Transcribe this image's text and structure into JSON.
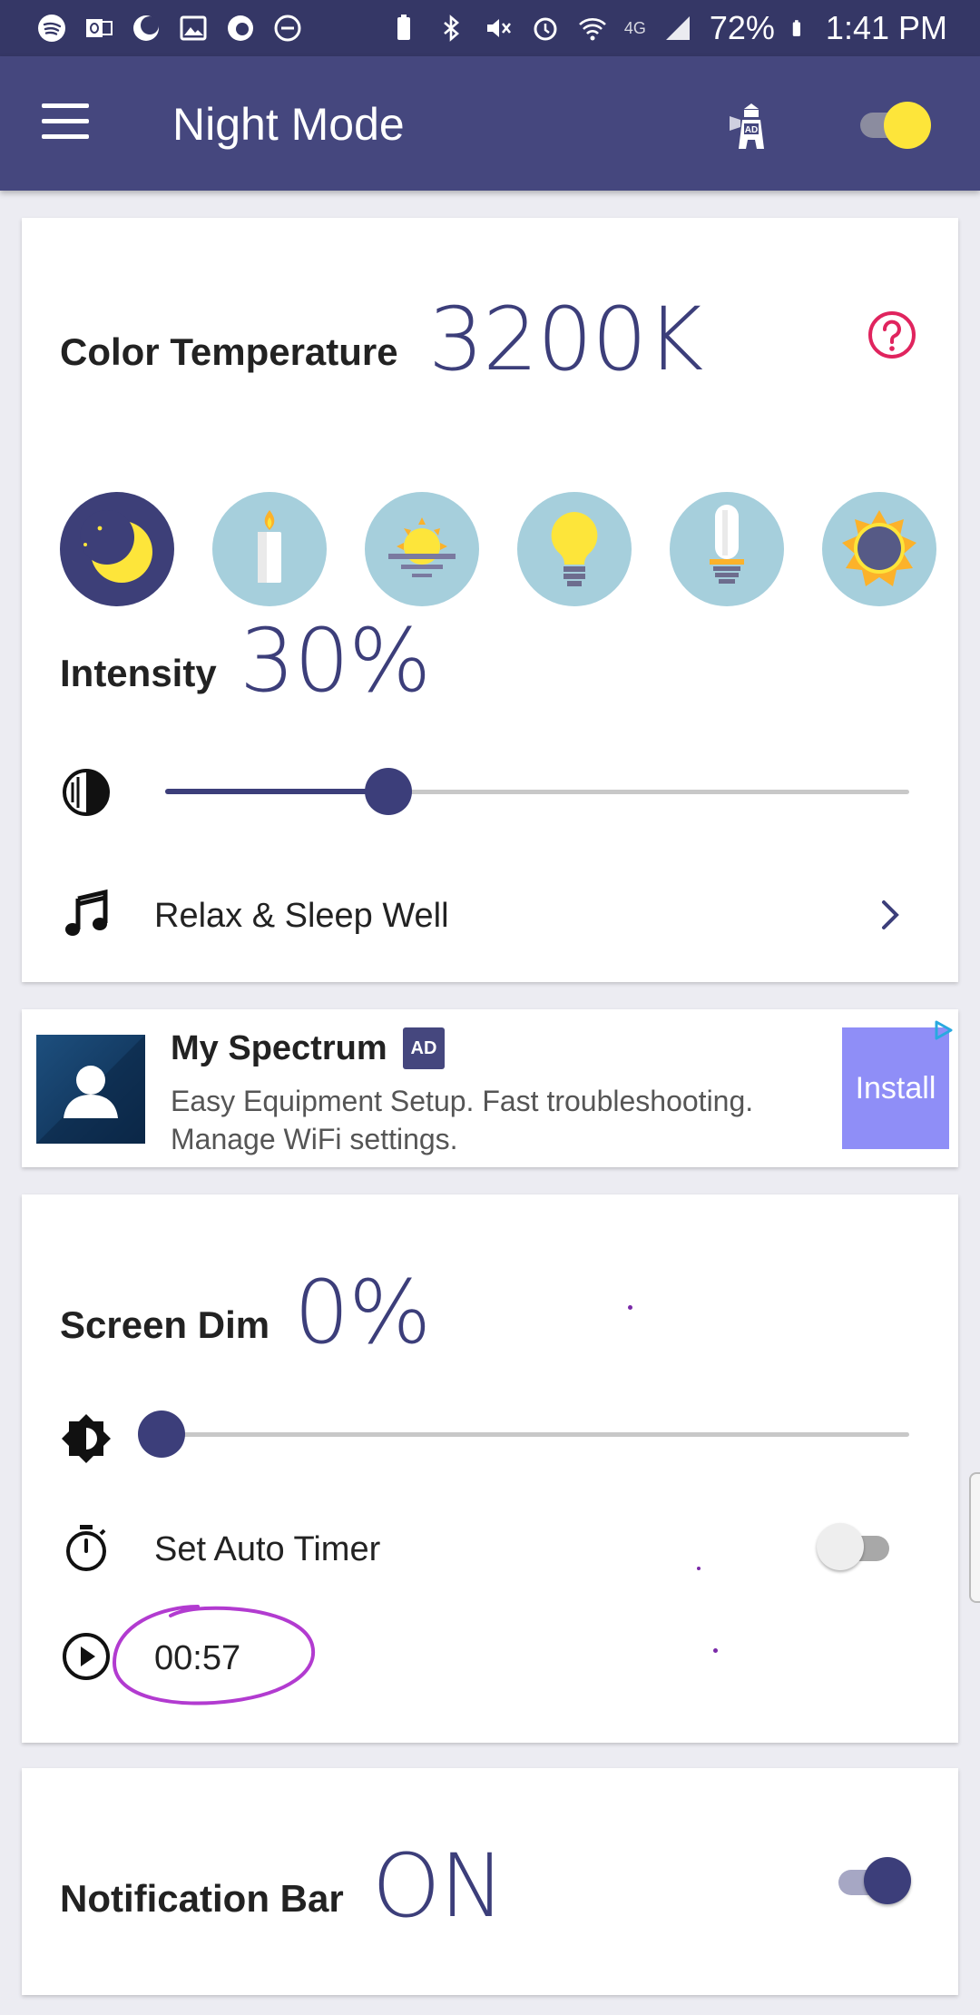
{
  "status_bar": {
    "battery": "72%",
    "time": "1:41 PM",
    "network": "4G"
  },
  "app_bar": {
    "title": "Night Mode",
    "icons": [
      "menu-icon",
      "ad-tower-icon"
    ],
    "master_switch_on": true,
    "master_switch_color": "#fde53a"
  },
  "color_temperature": {
    "label": "Color Temperature",
    "value": "3200K",
    "help_icon": "help-circle-icon",
    "presets": [
      {
        "name": "moon",
        "selected": true
      },
      {
        "name": "candle",
        "selected": false
      },
      {
        "name": "sunset",
        "selected": false
      },
      {
        "name": "bulb",
        "selected": false
      },
      {
        "name": "fluorescent",
        "selected": false
      },
      {
        "name": "sun",
        "selected": false
      }
    ]
  },
  "intensity": {
    "label": "Intensity",
    "value": "30%",
    "level": 0.3
  },
  "relax": {
    "label": "Relax & Sleep Well"
  },
  "ad": {
    "title": "My Spectrum",
    "badge": "AD",
    "description": "Easy Equipment Setup. Fast troubleshooting. Manage WiFi settings.",
    "install_label": "Install"
  },
  "screen_dim": {
    "label": "Screen Dim",
    "value": "0%",
    "level": 0.0
  },
  "auto_timer": {
    "label": "Set Auto Timer",
    "enabled": false
  },
  "timer": {
    "value": "00:57"
  },
  "notification_bar": {
    "label": "Notification Bar",
    "value": "ON",
    "enabled": true
  },
  "colors": {
    "primary": "#45477e",
    "accent": "#3c3e7a",
    "help": "#e0245e",
    "annotation": "#b23bd0"
  }
}
